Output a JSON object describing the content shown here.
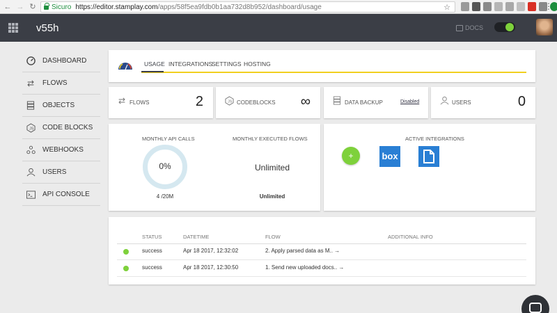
{
  "browser": {
    "secure_label": "Sicuro",
    "url_host": "https://editor.stamplay.com",
    "url_path": "/apps/58f5ea9fdb0b1aa732d8b952/dashboard/usage"
  },
  "header": {
    "app_name": "v55h",
    "docs_label": "DOCS"
  },
  "sidebar": {
    "items": [
      {
        "label": "DASHBOARD",
        "icon": "speedometer-icon"
      },
      {
        "label": "FLOWS",
        "icon": "shuffle-icon"
      },
      {
        "label": "OBJECTS",
        "icon": "database-icon"
      },
      {
        "label": "CODE BLOCKS",
        "icon": "nodejs-icon"
      },
      {
        "label": "WEBHOOKS",
        "icon": "webhook-icon"
      },
      {
        "label": "USERS",
        "icon": "user-icon"
      },
      {
        "label": "API CONSOLE",
        "icon": "terminal-icon"
      }
    ]
  },
  "tabs": [
    {
      "label": "USAGE",
      "active": true
    },
    {
      "label": "INTEGRATIONS",
      "active": false
    },
    {
      "label": "SETTINGS",
      "active": false
    },
    {
      "label": "HOSTING",
      "active": false
    }
  ],
  "stats": {
    "flows": {
      "label": "FLOWS",
      "value": "2"
    },
    "codeblocks": {
      "label": "CODEBLOCKS",
      "value": "∞"
    },
    "backup": {
      "label": "DATA BACKUP",
      "status": "Disabled"
    },
    "users": {
      "label": "USERS",
      "value": "0"
    }
  },
  "api": {
    "title": "MONTHLY API CALLS",
    "percent": "0%",
    "count": "4 /20M"
  },
  "executed": {
    "title": "MONTHLY EXECUTED FLOWS",
    "value": "Unlimited",
    "sub": "Unlimited"
  },
  "integrations": {
    "title": "ACTIVE INTEGRATIONS",
    "add": "+",
    "box_label": "box"
  },
  "logs": {
    "headers": [
      "STATUS",
      "DATETIME",
      "FLOW",
      "ADDITIONAL INFO"
    ],
    "rows": [
      {
        "status": "success",
        "datetime": "Apr 18 2017, 12:32:02",
        "flow": "2. Apply parsed data as M.. →"
      },
      {
        "status": "success",
        "datetime": "Apr 18 2017, 12:30:50",
        "flow": "1. Send new uploaded docs.. →"
      }
    ]
  },
  "colors": {
    "header_bg": "#3b3e46",
    "accent_green": "#7ed13b",
    "tab_underline": "#f1cf1f",
    "integration_blue": "#2a7fd4"
  }
}
